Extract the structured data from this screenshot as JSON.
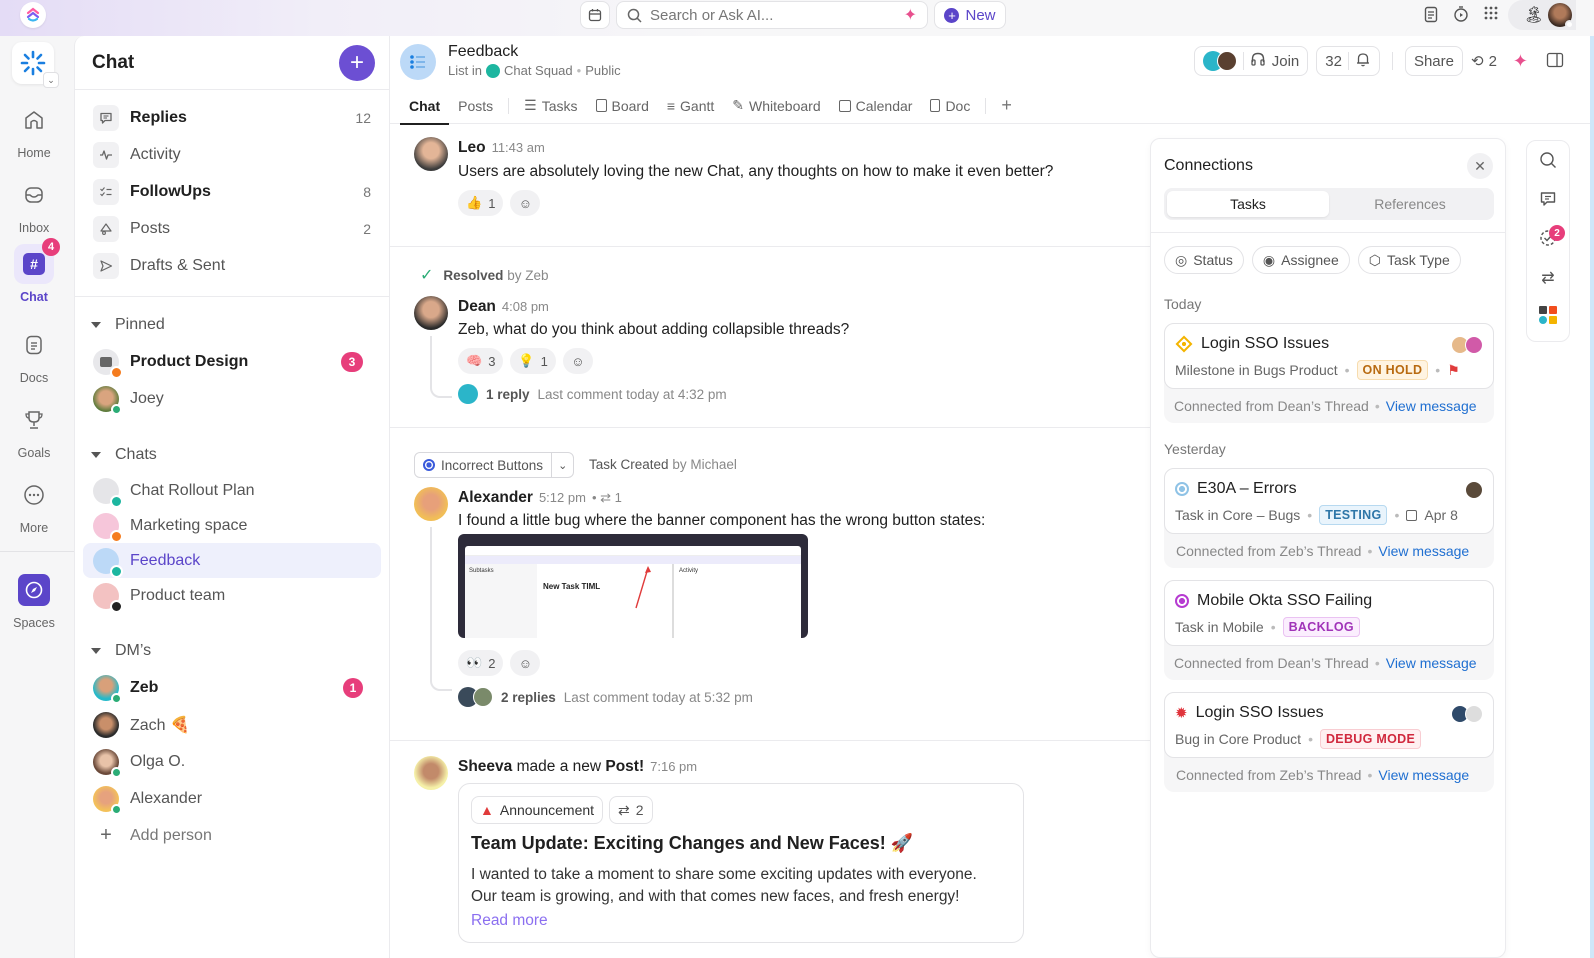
{
  "topbar": {
    "search_placeholder": "Search or Ask AI...",
    "new_label": "New"
  },
  "rail": {
    "items": [
      {
        "label": "Home",
        "icon": "home-icon"
      },
      {
        "label": "Inbox",
        "icon": "inbox-icon"
      },
      {
        "label": "Chat",
        "icon": "hash-icon",
        "badge": "4",
        "active": true
      },
      {
        "label": "Docs",
        "icon": "doc-icon"
      },
      {
        "label": "Goals",
        "icon": "trophy-icon"
      },
      {
        "label": "More",
        "icon": "more-icon"
      },
      {
        "label": "Spaces",
        "icon": "compass-icon"
      }
    ]
  },
  "sidebar": {
    "title": "Chat",
    "nav": [
      {
        "label": "Replies",
        "count": "12",
        "bold": true,
        "icon": "comment-icon"
      },
      {
        "label": "Activity",
        "count": "",
        "bold": false,
        "icon": "activity-icon"
      },
      {
        "label": "FollowUps",
        "count": "8",
        "bold": true,
        "icon": "checklist-icon"
      },
      {
        "label": "Posts",
        "count": "2",
        "bold": false,
        "icon": "megaphone-icon"
      },
      {
        "label": "Drafts & Sent",
        "count": "",
        "bold": false,
        "icon": "send-icon"
      }
    ],
    "pinned_label": "Pinned",
    "pinned": [
      {
        "label": "Product Design",
        "badge": "3",
        "bold": true
      },
      {
        "label": "Joey"
      }
    ],
    "chats_label": "Chats",
    "chats": [
      {
        "label": "Chat Rollout Plan"
      },
      {
        "label": "Marketing space"
      },
      {
        "label": "Feedback",
        "active": true
      },
      {
        "label": "Product team"
      }
    ],
    "dms_label": "DM’s",
    "dms": [
      {
        "label": "Zeb",
        "badge": "1",
        "bold": true
      },
      {
        "label": "Zach 🍕"
      },
      {
        "label": "Olga O."
      },
      {
        "label": "Alexander"
      }
    ],
    "add_person": "Add person"
  },
  "channel": {
    "title": "Feedback",
    "list_in": "List in",
    "space": "Chat Squad",
    "visibility": "Public",
    "join_label": "Join",
    "followers": "32",
    "share_label": "Share",
    "connections_count": "2",
    "tabs": [
      "Chat",
      "Posts",
      "Tasks",
      "Board",
      "Gantt",
      "Whiteboard",
      "Calendar",
      "Doc"
    ]
  },
  "messages": {
    "leo": {
      "name": "Leo",
      "time": "11:43 am",
      "text": "Users are absolutely loving the new Chat, any thoughts on how to make it even better?",
      "reactions": [
        {
          "emoji": "👍",
          "count": "1"
        }
      ]
    },
    "resolved": {
      "label": "Resolved",
      "by": "by Zeb"
    },
    "dean": {
      "name": "Dean",
      "time": "4:08 pm",
      "text": "Zeb, what do you think about adding collapsible threads?",
      "reactions": [
        {
          "emoji": "🧠",
          "count": "3"
        },
        {
          "emoji": "💡",
          "count": "1"
        }
      ],
      "replies": "1 reply",
      "last": "Last comment today at 4:32 pm"
    },
    "task_chip": "Incorrect Buttons",
    "task_created": "Task Created",
    "task_by": "by Michael",
    "alexander": {
      "name": "Alexander",
      "time": "5:12 pm",
      "links": "1",
      "text": "I found a little bug where the banner component has the wrong button states:",
      "reactions": [
        {
          "emoji": "👀",
          "count": "2"
        }
      ],
      "replies": "2 replies",
      "last": "Last comment today at 5:32 pm",
      "shot_title": "New Task TIML",
      "shot_panel_left": "Subtasks",
      "shot_panel_right": "Activity"
    },
    "sheeva": {
      "name": "Sheeva",
      "made": "made a new",
      "post": "Post!",
      "time": "7:16 pm",
      "tag": "Announcement",
      "links": "2",
      "title": "Team Update: Exciting Changes and New Faces! 🚀",
      "body1": "I wanted to take a moment to share some exciting updates with everyone.",
      "body2": "Our team is growing, and with that comes new faces, and fresh energy!",
      "read_more": "Read more"
    }
  },
  "connections": {
    "title": "Connections",
    "tabs": [
      "Tasks",
      "References"
    ],
    "filters": [
      "Status",
      "Assignee",
      "Task Type"
    ],
    "groups": [
      "Today",
      "Yesterday"
    ],
    "cards": [
      {
        "title": "Login SSO Issues",
        "meta": "Milestone in Bugs Product",
        "status": "ON HOLD",
        "status_color": "#b86a10",
        "status_bg": "#fff4e2",
        "status_border": "#f7dcae",
        "icon_color": "#f4b400",
        "from": "Connected from Dean’s Thread",
        "link": "View message"
      },
      {
        "title": "E30A – Errors",
        "meta": "Task in Core – Bugs",
        "status": "TESTING",
        "status_color": "#2e76a8",
        "status_bg": "#e9f4fc",
        "status_border": "#b7d9f0",
        "icon_color": "#8fc3e6",
        "date": "Apr 8",
        "from": "Connected from Zeb’s Thread",
        "link": "View message"
      },
      {
        "title": "Mobile Okta SSO Failing",
        "meta": "Task in Mobile",
        "status": "BACKLOG",
        "status_color": "#a033b8",
        "status_bg": "#fbeefe",
        "status_border": "#eac2f2",
        "icon_color": "#b63bd1",
        "from": "Connected from Dean’s Thread",
        "link": "View message"
      },
      {
        "title": "Login SSO Issues",
        "meta": "Bug in Core Product",
        "status": "DEBUG MODE",
        "status_color": "#d0283d",
        "status_bg": "#fff0f1",
        "status_border": "#f8cdd2",
        "icon_color": "#e0343c",
        "from": "Connected from Zeb’s Thread",
        "link": "View message"
      }
    ]
  },
  "right_rail": {
    "badge": "2"
  }
}
